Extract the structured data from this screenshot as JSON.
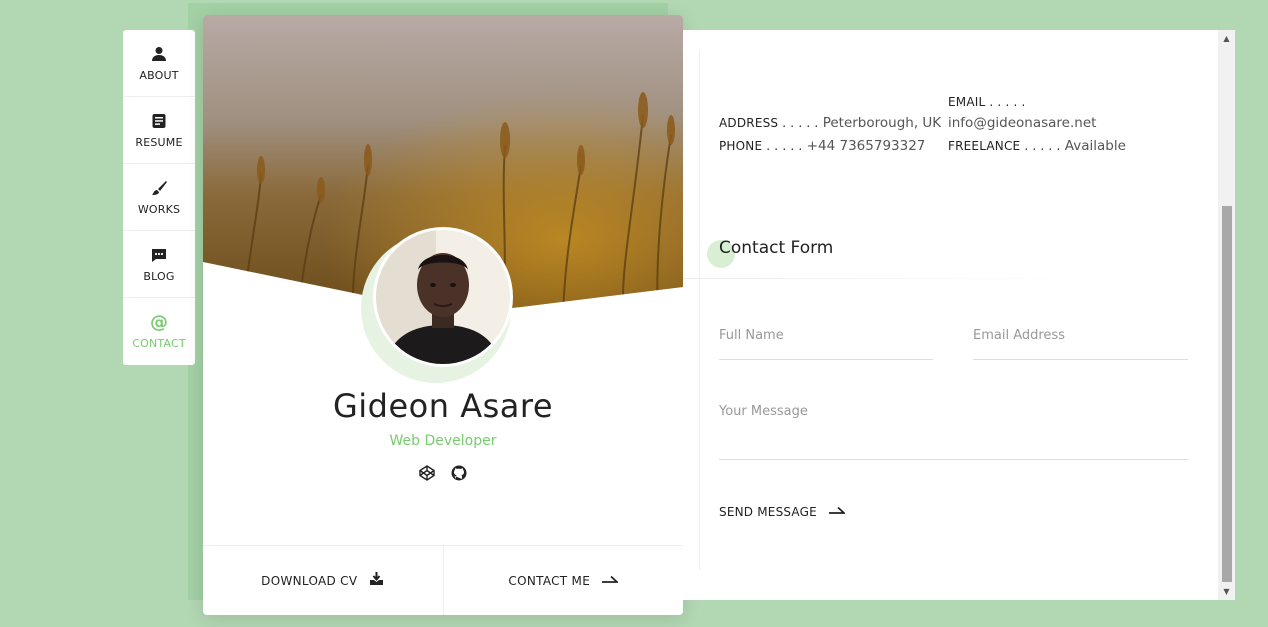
{
  "menu": {
    "items": [
      {
        "label": "ABOUT",
        "icon": "person-icon",
        "active": false
      },
      {
        "label": "RESUME",
        "icon": "document-icon",
        "active": false
      },
      {
        "label": "WORKS",
        "icon": "brush-icon",
        "active": false
      },
      {
        "label": "BLOG",
        "icon": "chat-icon",
        "active": false
      },
      {
        "label": "CONTACT",
        "icon": "at-icon",
        "active": true
      }
    ]
  },
  "profile": {
    "name": "Gideon Asare",
    "role": "Web Developer",
    "socials": [
      "codepen-icon",
      "github-icon"
    ],
    "download_cv_label": "DOWNLOAD CV",
    "contact_me_label": "CONTACT ME"
  },
  "info": {
    "address_key": "ADDRESS . . . . .",
    "address_value": "Peterborough, UK",
    "phone_key": "PHONE . . . . .",
    "phone_value": "+44 7365793327",
    "email_key": "EMAIL . . . . .",
    "email_value": "info@gideonasare.net",
    "freelance_key": "FREELANCE . . . . .",
    "freelance_value": "Available"
  },
  "contact_form": {
    "title": "Contact Form",
    "full_name_placeholder": "Full Name",
    "email_placeholder": "Email Address",
    "message_placeholder": "Your Message",
    "send_label": "SEND MESSAGE"
  },
  "colors": {
    "accent": "#78cc6d",
    "page_background": "#b2d7b3"
  }
}
